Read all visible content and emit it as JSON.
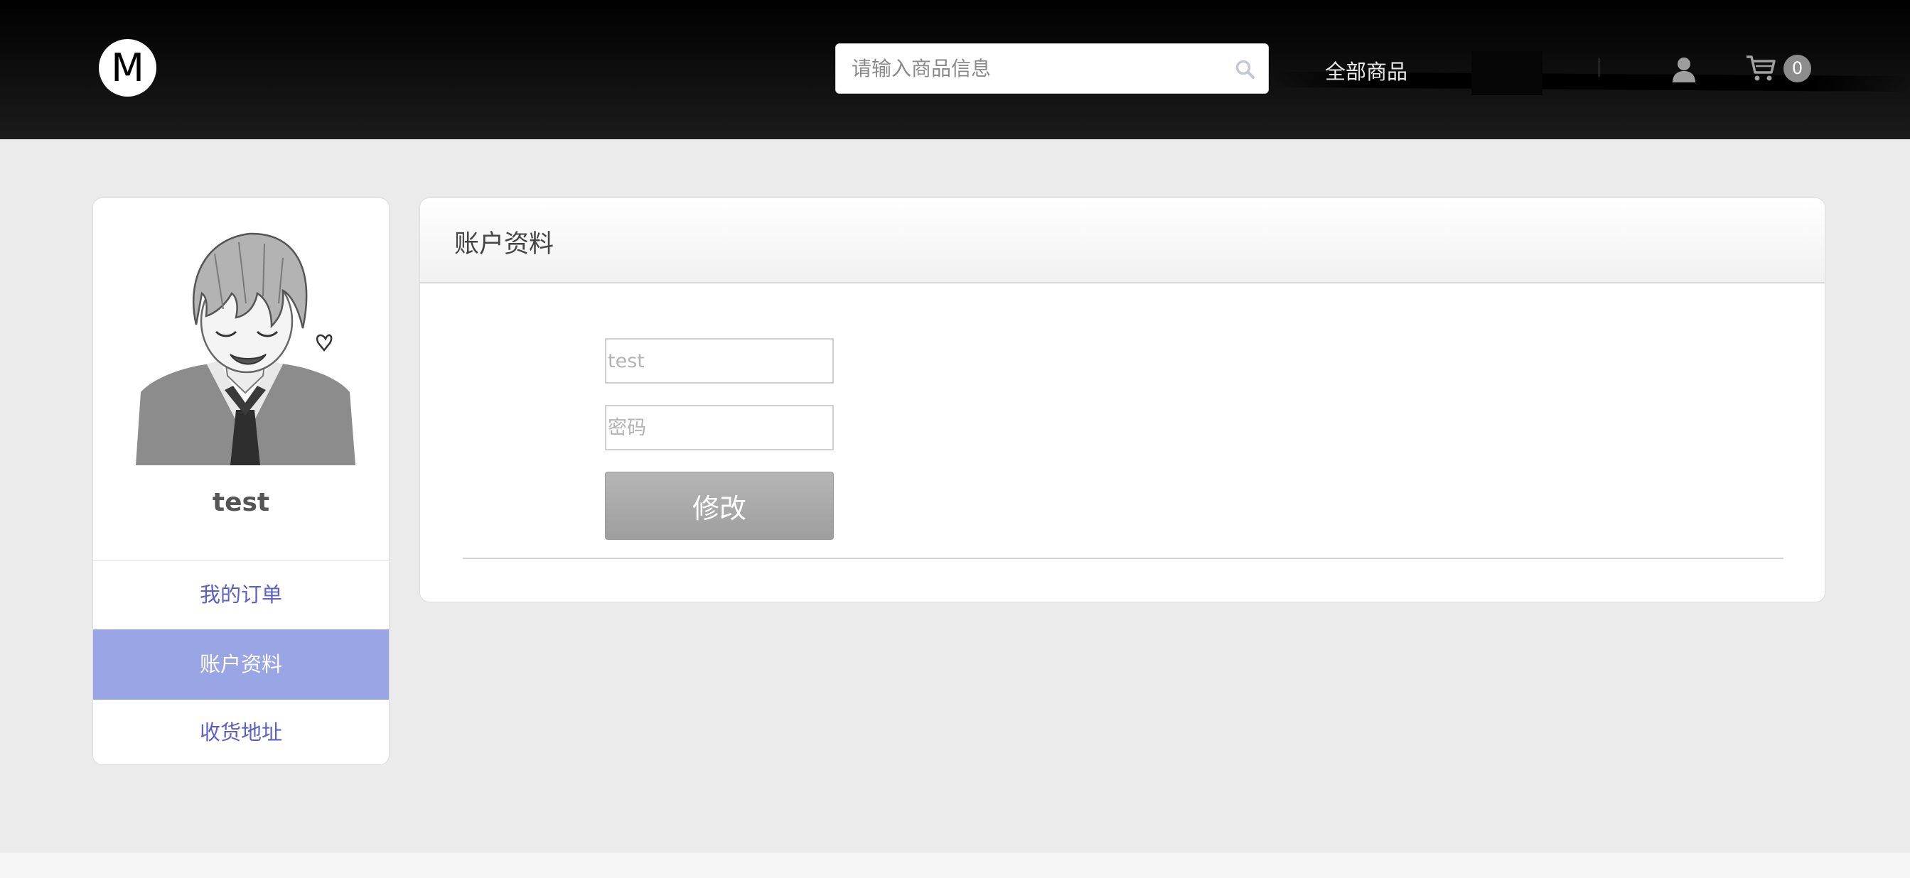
{
  "header": {
    "logo_text": "M",
    "search": {
      "placeholder": "请输入商品信息"
    },
    "nav_all_products": "全部商品",
    "cart_count": "0",
    "icons": {
      "search": "search-icon",
      "user": "user-icon",
      "cart": "cart-icon"
    }
  },
  "sidebar": {
    "username": "test",
    "items": [
      {
        "label": "我的订单",
        "active": false
      },
      {
        "label": "账户资料",
        "active": true
      },
      {
        "label": "收货地址",
        "active": false
      }
    ]
  },
  "panel": {
    "title": "账户资料",
    "fields": {
      "username_placeholder": "test",
      "password_placeholder": "密码"
    },
    "submit_label": "修改"
  },
  "colors": {
    "accent": "#9aa5e6",
    "link": "#5b5fc7",
    "header_bg": "#000000",
    "page_bg": "#ebebeb"
  }
}
